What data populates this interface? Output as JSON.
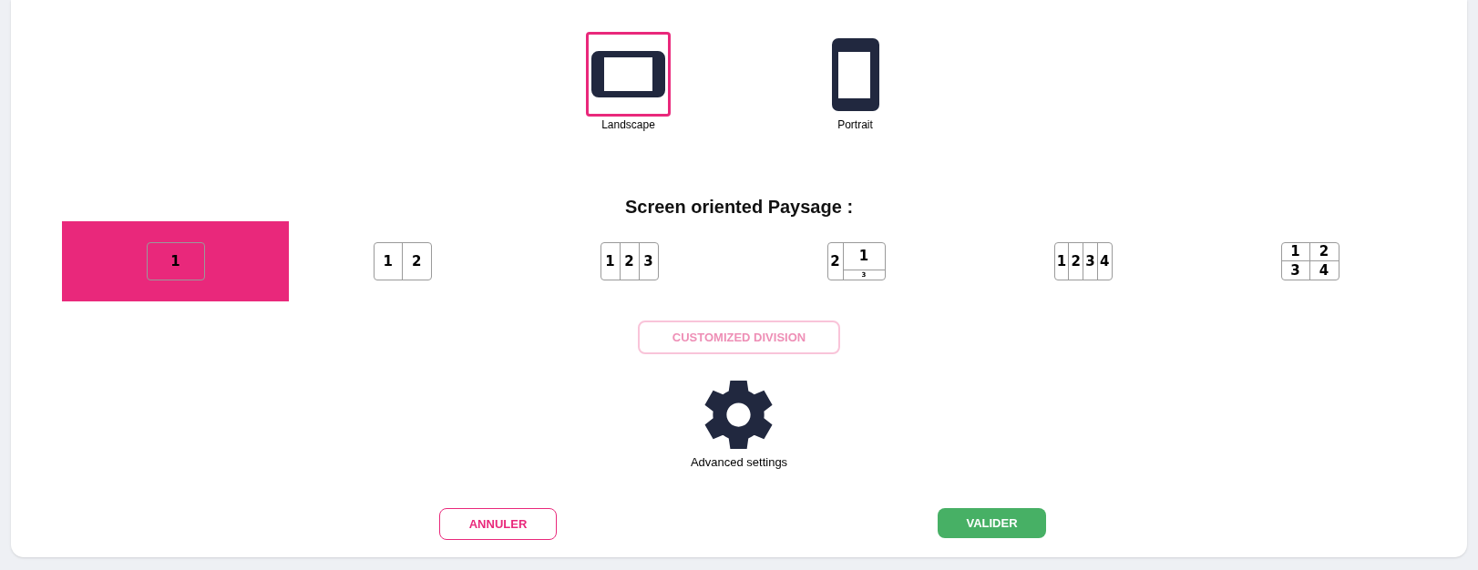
{
  "orientations": [
    {
      "kind": "landscape",
      "label": "Landscape",
      "selected": true
    },
    {
      "kind": "portrait",
      "label": "Portrait",
      "selected": false
    }
  ],
  "title": "Screen oriented Paysage :",
  "layouts": [
    {
      "kind": "columns",
      "selected": true,
      "cells": [
        "1"
      ]
    },
    {
      "kind": "columns",
      "selected": false,
      "cells": [
        "1",
        "2"
      ]
    },
    {
      "kind": "columns",
      "selected": false,
      "cells": [
        "1",
        "2",
        "3"
      ]
    },
    {
      "kind": "split",
      "selected": false,
      "cells": [
        "2",
        "1",
        "3"
      ]
    },
    {
      "kind": "columns",
      "selected": false,
      "cells": [
        "1",
        "2",
        "3",
        "4"
      ]
    },
    {
      "kind": "grid",
      "selected": false,
      "cells": [
        "1",
        "2",
        "3",
        "4"
      ]
    }
  ],
  "custom_button": {
    "label": "CUSTOMIZED DIVISION",
    "disabled": true
  },
  "advanced": {
    "label": "Advanced settings"
  },
  "buttons": [
    {
      "kind": "outline",
      "label": "ANNULER"
    },
    {
      "kind": "primary",
      "label": "VALIDER"
    }
  ]
}
